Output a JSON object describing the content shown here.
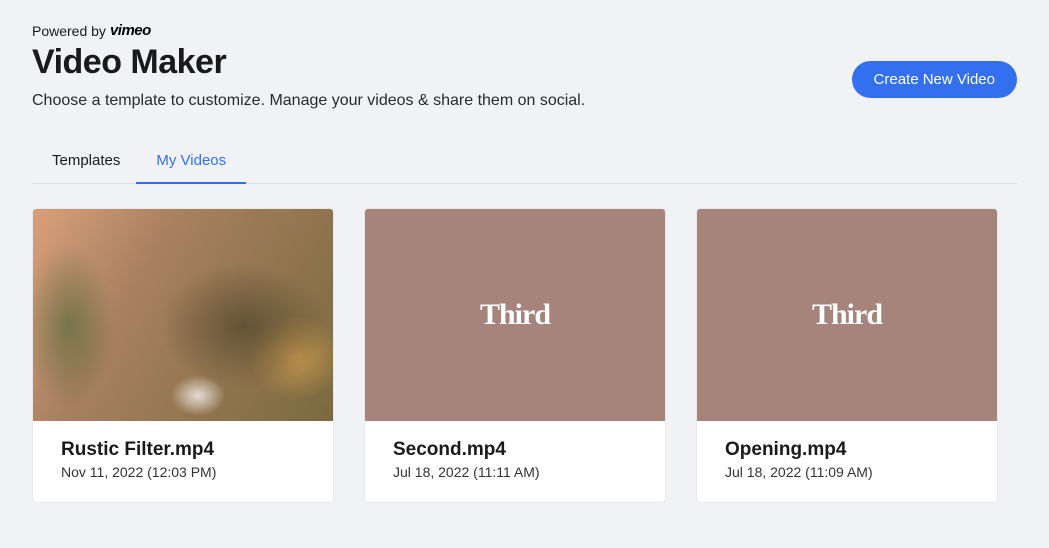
{
  "header": {
    "powered_by_prefix": "Powered by",
    "brand": "vimeo",
    "title": "Video Maker",
    "subtitle": "Choose a template to customize. Manage your videos & share them on social.",
    "create_button": "Create New Video"
  },
  "tabs": {
    "templates": "Templates",
    "my_videos": "My Videos"
  },
  "videos": [
    {
      "title": "Rustic Filter.mp4",
      "date": "Nov 11, 2022 (12:03 PM)",
      "thumb_style": "rustic",
      "thumb_text": ""
    },
    {
      "title": "Second.mp4",
      "date": "Jul 18, 2022 (11:11 AM)",
      "thumb_style": "brown",
      "thumb_text": "Third"
    },
    {
      "title": "Opening.mp4",
      "date": "Jul 18, 2022 (11:09 AM)",
      "thumb_style": "brown",
      "thumb_text": "Third"
    }
  ]
}
